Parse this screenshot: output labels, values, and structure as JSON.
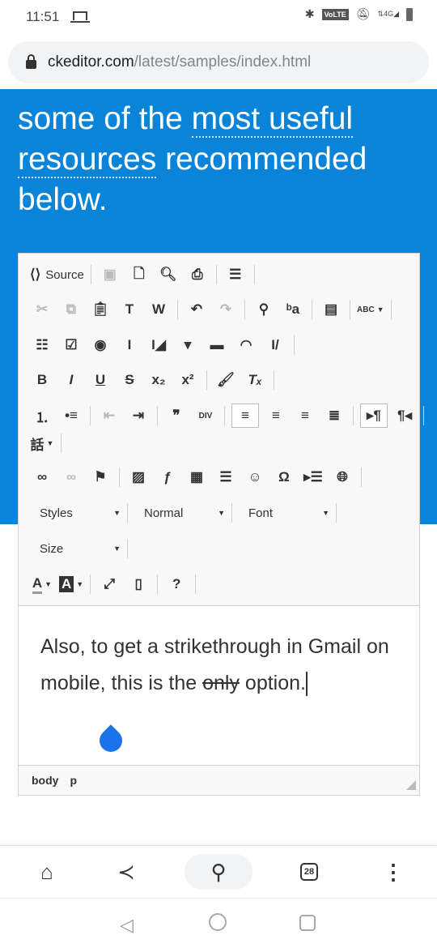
{
  "status_bar": {
    "time": "11:51",
    "icons": [
      "laptop-icon",
      "bluetooth-icon",
      "volte-badge",
      "bell-off-icon",
      "data-arrows-icon",
      "signal-4g-icon",
      "battery-icon"
    ],
    "volte": "VoLTE",
    "network": "4G"
  },
  "address_bar": {
    "host": "ckeditor.com",
    "path": "/latest/samples/index.html"
  },
  "hero": {
    "line1_prefix": "some of the ",
    "line1_link": "most useful",
    "line2_link": "resources",
    "line2_suffix": " recommended",
    "line3": "below.",
    "color": "#0a84d8"
  },
  "toolbar": {
    "rows": [
      [
        [
          {
            "icon": "source",
            "label": "Source"
          }
        ],
        [
          {
            "icon": "save",
            "disabled": true
          },
          {
            "icon": "new-page"
          },
          {
            "icon": "preview"
          },
          {
            "icon": "print"
          }
        ],
        [
          {
            "icon": "templates"
          }
        ]
      ],
      [
        [
          {
            "icon": "cut",
            "disabled": true
          },
          {
            "icon": "copy",
            "disabled": true
          },
          {
            "icon": "paste"
          },
          {
            "icon": "paste-text"
          },
          {
            "icon": "paste-word"
          }
        ],
        [
          {
            "icon": "undo"
          },
          {
            "icon": "redo",
            "disabled": true
          }
        ],
        [
          {
            "icon": "find"
          },
          {
            "icon": "replace"
          }
        ],
        [
          {
            "icon": "select-all"
          }
        ],
        [
          {
            "icon": "spellcheck",
            "dropdown": true
          }
        ]
      ],
      [
        [
          {
            "icon": "form"
          },
          {
            "icon": "checkbox"
          },
          {
            "icon": "radio"
          },
          {
            "icon": "text-field"
          },
          {
            "icon": "textarea"
          },
          {
            "icon": "select"
          },
          {
            "icon": "button"
          },
          {
            "icon": "image-button"
          },
          {
            "icon": "hidden-field"
          }
        ]
      ],
      [
        [
          {
            "icon": "bold"
          },
          {
            "icon": "italic"
          },
          {
            "icon": "underline"
          },
          {
            "icon": "strike"
          },
          {
            "icon": "subscript"
          },
          {
            "icon": "superscript"
          }
        ],
        [
          {
            "icon": "copy-format"
          },
          {
            "icon": "remove-format"
          }
        ]
      ],
      [
        [
          {
            "icon": "numbered-list"
          },
          {
            "icon": "bulleted-list"
          }
        ],
        [
          {
            "icon": "outdent",
            "disabled": true
          },
          {
            "icon": "indent"
          }
        ],
        [
          {
            "icon": "blockquote"
          },
          {
            "icon": "div"
          }
        ],
        [
          {
            "icon": "align-left",
            "active": true
          },
          {
            "icon": "align-center"
          },
          {
            "icon": "align-right"
          },
          {
            "icon": "justify"
          }
        ],
        [
          {
            "icon": "ltr",
            "active": true
          },
          {
            "icon": "rtl"
          }
        ]
      ],
      [
        [
          {
            "icon": "language",
            "dropdown": true
          }
        ]
      ],
      [
        [
          {
            "icon": "link"
          },
          {
            "icon": "unlink",
            "disabled": true
          },
          {
            "icon": "anchor"
          }
        ],
        [
          {
            "icon": "image"
          },
          {
            "icon": "flash"
          },
          {
            "icon": "table"
          },
          {
            "icon": "horizontal-rule"
          },
          {
            "icon": "smiley"
          },
          {
            "icon": "special-char"
          },
          {
            "icon": "page-break"
          },
          {
            "icon": "iframe"
          }
        ]
      ]
    ],
    "combos_row1": [
      "Styles",
      "Normal",
      "Font"
    ],
    "combos_row2": [
      "Size"
    ],
    "last_row": [
      [
        {
          "icon": "text-color",
          "dropdown": true
        },
        {
          "icon": "bg-color",
          "dropdown": true
        }
      ],
      [
        {
          "icon": "maximize"
        },
        {
          "icon": "show-blocks"
        }
      ],
      [
        {
          "icon": "about"
        }
      ]
    ]
  },
  "content": {
    "text_before": "Also, to get a strikethrough in Gmail on mobile, this is the ",
    "strike": "only",
    "text_after": " option."
  },
  "element_path": [
    "body",
    "p"
  ],
  "bottom_bar": {
    "tab_count": "28",
    "items": [
      "home-icon",
      "share-icon",
      "search-icon",
      "tabs-icon",
      "more-icon"
    ]
  },
  "nav_bar": [
    "back-icon",
    "home-circle-icon",
    "recents-icon"
  ]
}
